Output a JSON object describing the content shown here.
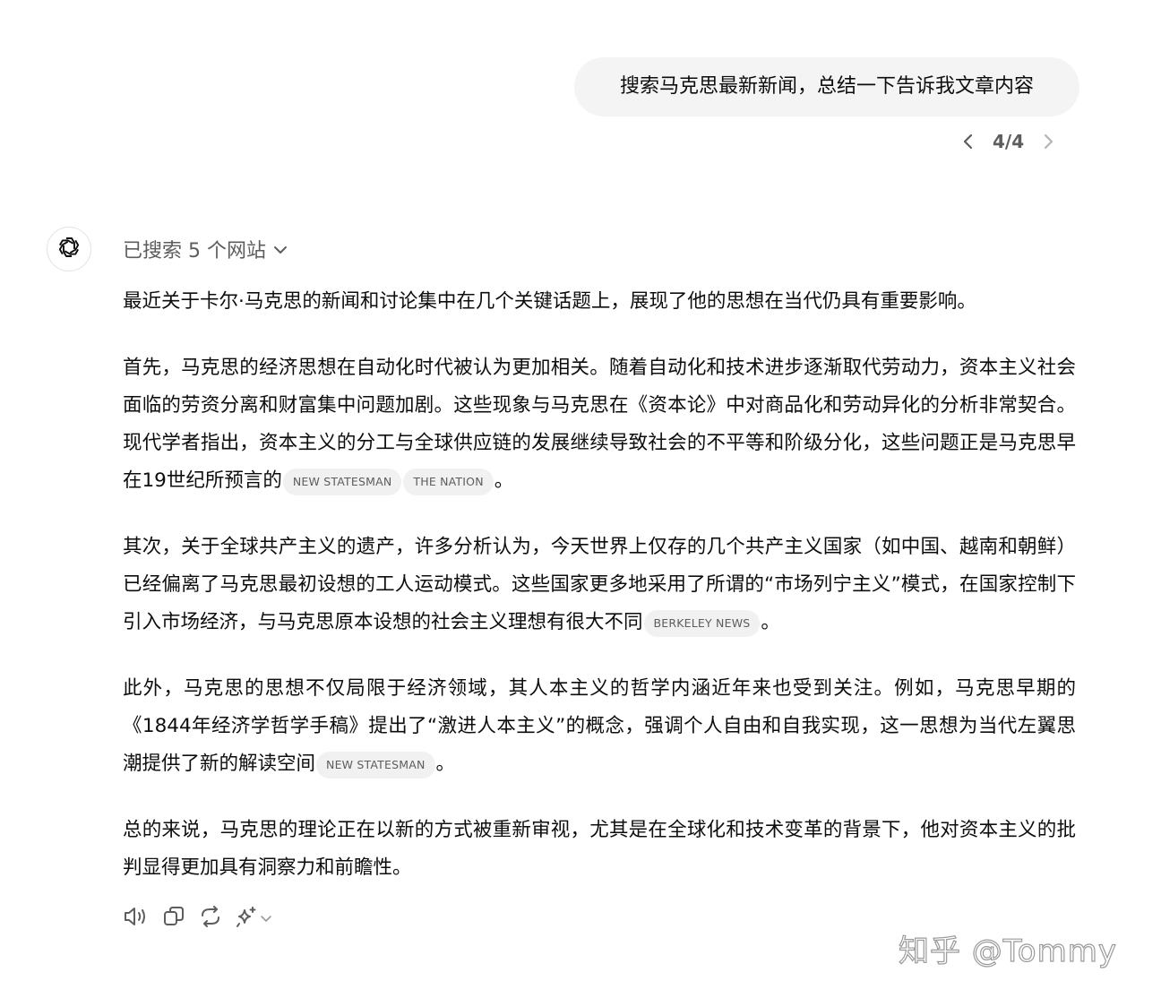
{
  "user_message": "搜索马克思最新新闻，总结一下告诉我文章内容",
  "pager": {
    "count": "4/4"
  },
  "assistant": {
    "searched_label": "已搜索 5 个网站",
    "paragraphs": [
      {
        "text": "最近关于卡尔·马克思的新闻和讨论集中在几个关键话题上，展现了他的思想在当代仍具有重要影响。",
        "citations": [],
        "tail": ""
      },
      {
        "text": "首先，马克思的经济思想在自动化时代被认为更加相关。随着自动化和技术进步逐渐取代劳动力，资本主义社会面临的劳资分离和财富集中问题加剧。这些现象与马克思在《资本论》中对商品化和劳动异化的分析非常契合。现代学者指出，资本主义的分工与全球供应链的发展继续导致社会的不平等和阶级分化，这些问题正是马克思早在19世纪所预言的",
        "citations": [
          "NEW STATESMAN",
          "THE NATION"
        ],
        "tail": "。"
      },
      {
        "text": "其次，关于全球共产主义的遗产，许多分析认为，今天世界上仅存的几个共产主义国家（如中国、越南和朝鲜）已经偏离了马克思最初设想的工人运动模式。这些国家更多地采用了所谓的“市场列宁主义”模式，在国家控制下引入市场经济，与马克思原本设想的社会主义理想有很大不同",
        "citations": [
          "BERKELEY NEWS"
        ],
        "tail": "。"
      },
      {
        "text": "此外，马克思的思想不仅局限于经济领域，其人本主义的哲学内涵近年来也受到关注。例如，马克思早期的《1844年经济学哲学手稿》提出了“激进人本主义”的概念，强调个人自由和自我实现，这一思想为当代左翼思潮提供了新的解读空间",
        "citations": [
          "NEW STATESMAN"
        ],
        "tail": "。"
      },
      {
        "text": "总的来说，马克思的理论正在以新的方式被重新审视，尤其是在全球化和技术变革的背景下，他对资本主义的批判显得更加具有洞察力和前瞻性。",
        "citations": [],
        "tail": ""
      }
    ]
  },
  "action_icons": [
    "speaker-icon",
    "copy-icon",
    "regenerate-icon",
    "sparkle-model-icon"
  ],
  "watermark": "知乎 @Tommy"
}
